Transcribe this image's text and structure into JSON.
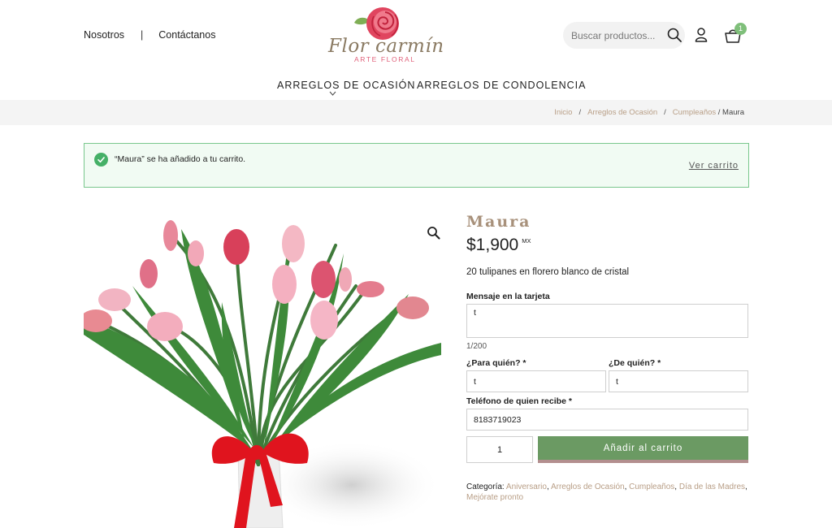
{
  "header": {
    "links": {
      "about": "Nosotros",
      "separator": "|",
      "contact": "Contáctanos"
    },
    "logo": {
      "name": "Flor carmín",
      "subtitle": "ARTE FLORAL"
    },
    "search": {
      "placeholder": "Buscar productos..."
    },
    "cart": {
      "count": "1"
    },
    "icons": [
      "search-icon",
      "user-icon",
      "basket-icon",
      "rose-logo-icon"
    ]
  },
  "nav": {
    "items": [
      {
        "label": "ARREGLOS DE OCASIÓN"
      },
      {
        "label": "ARREGLOS DE CONDOLENCIA"
      }
    ]
  },
  "breadcrumb": {
    "home": "Inicio",
    "level1": "Arreglos de Ocasión",
    "level2": "Cumpleaños",
    "separator": "/",
    "current": "/ Maura"
  },
  "notice": {
    "message": "“Maura” se ha añadido a tu carrito.",
    "action": "Ver carrito"
  },
  "product": {
    "title": "Maura",
    "price": "$1,900",
    "currency": "MX",
    "description": "20 tulipanes en florero blanco de cristal",
    "message_label": "Mensaje en la tarjeta",
    "message_value": "t",
    "message_counter": "1/200",
    "to_label": "¿Para quién? *",
    "to_value": "t",
    "from_label": "¿De quién? *",
    "from_value": "t",
    "phone_label": "Teléfono de quien recibe *",
    "phone_value": "8183719023",
    "quantity": "1",
    "add_to_cart": "Añadir al carrito",
    "category_label": "Categoría: ",
    "categories": [
      "Aniversario",
      "Arreglos de Ocasión",
      "Cumpleaños",
      "Día de las Madres",
      "Mejórate pronto"
    ]
  },
  "colors": {
    "accent_green": "#6b9a63",
    "notice_border": "#79c78c",
    "link_brown": "#b89e86",
    "title_taupe": "#a8917b",
    "logo_pink": "#e0607a"
  }
}
